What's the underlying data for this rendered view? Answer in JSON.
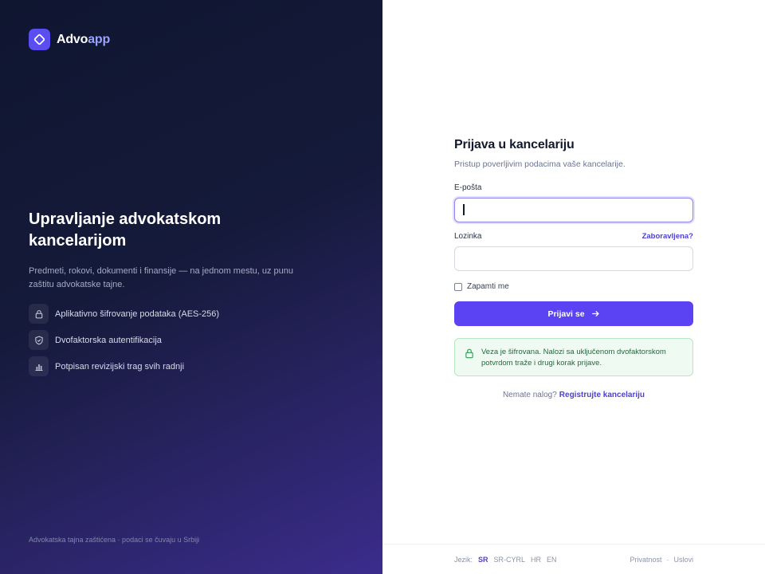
{
  "brand": {
    "name_part1": "Advo",
    "name_part2": "app"
  },
  "hero": {
    "title": "Upravljanje advokatskom kancelarijom",
    "description": "Predmeti, rokovi, dokumenti i finansije — na jednom mestu, uz punu zaštitu advokatske tajne."
  },
  "features": [
    {
      "icon": "lock-icon",
      "label": "Aplikativno šifrovanje podataka (AES-256)"
    },
    {
      "icon": "shield-check-icon",
      "label": "Dvofaktorska autentifikacija"
    },
    {
      "icon": "bar-chart-icon",
      "label": "Potpisan revizijski trag svih radnji"
    }
  ],
  "left_footer": "Advokatska tajna zaštićena · podaci se čuvaju u Srbiji",
  "form": {
    "title": "Prijava u kancelariju",
    "subtitle": "Pristup poverljivim podacima vaše kancelarije.",
    "email_label": "E-pošta",
    "email_value": "",
    "password_label": "Lozinka",
    "password_value": "",
    "forgot_label": "Zaboravljena?",
    "remember_label": "Zapamti me",
    "submit_label": "Prijavi se",
    "notice": "Veza je šifrovana. Nalozi sa uključenom dvofaktorskom potvrdom traže i drugi korak prijave.",
    "register_prompt": "Nemate nalog?",
    "register_link": "Registrujte kancelariju"
  },
  "footer": {
    "language_label": "Jezik:",
    "languages": [
      "SR",
      "SR-CYRL",
      "HR",
      "EN"
    ],
    "active_language": "SR",
    "privacy": "Privatnost",
    "separator": "·",
    "terms": "Uslovi"
  },
  "colors": {
    "accent": "#5b42f3",
    "brand_secondary": "#9aa2ff",
    "success_bg": "#effbf2",
    "success_text": "#1e6b3a"
  }
}
